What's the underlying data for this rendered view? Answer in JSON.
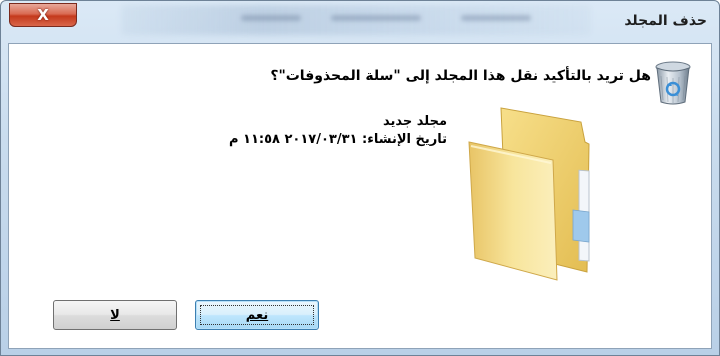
{
  "window": {
    "title": "حذف المجلد",
    "close_label": "X"
  },
  "dialog": {
    "question": "هل تريد بالتأكيد نقل هذا المجلد إلى \"سلة المحذوفات\"؟",
    "item_name": "مجلد جديد",
    "item_date": "تاريخ الإنشاء: ٢٠١٧/٠٣/٣١ ١١:٥٨ م"
  },
  "buttons": {
    "yes": "نعم",
    "no": "لا"
  },
  "icons": {
    "recycle_bin": "recycle-bin-icon",
    "folder": "folder-icon"
  }
}
